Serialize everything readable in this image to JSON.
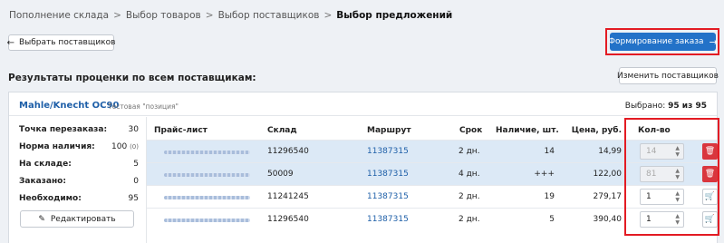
{
  "breadcrumb": {
    "items": [
      "Пополнение склада",
      "Выбор товаров",
      "Выбор поставщиков"
    ],
    "current": "Выбор предложений",
    "separator": ">"
  },
  "back_button": {
    "label": "Выбрать поставщиков",
    "icon": "arrow-left-icon"
  },
  "primary_button": {
    "label": "Формирование заказа",
    "icon": "arrow-right-icon",
    "color": "#2372c8"
  },
  "section_title": "Результаты проценки по всем поставщикам:",
  "change_button": {
    "label": "Изменить поставщиков"
  },
  "product": {
    "name": "Mahle/Knecht OC90",
    "note": "Тестовая \"позиция\"",
    "selected_label": "Выбрано:",
    "selected_count": "95 из 95"
  },
  "stats": [
    {
      "label": "Точка перезаказа:",
      "value": "30",
      "sub": ""
    },
    {
      "label": "Норма наличия:",
      "value": "100",
      "sub": "(0)"
    },
    {
      "label": "На складе:",
      "value": "5",
      "sub": ""
    },
    {
      "label": "Заказано:",
      "value": "0",
      "sub": ""
    },
    {
      "label": "Необходимо:",
      "value": "95",
      "sub": ""
    }
  ],
  "edit_button": {
    "label": "Редактировать",
    "icon": "pencil-icon"
  },
  "table": {
    "headers": {
      "pricelist": "Прайс-лист",
      "warehouse": "Склад",
      "route": "Маршрут",
      "term": "Срок",
      "stock": "Наличие, шт.",
      "price": "Цена, руб.",
      "qty": "Кол-во"
    },
    "rows": [
      {
        "warehouse": "11296540",
        "route": "11387315",
        "term": "2 дн.",
        "stock": "14",
        "price": "14,99",
        "qty": "14",
        "action": "trash-icon"
      },
      {
        "warehouse": "50009",
        "route": "11387315",
        "term": "4 дн.",
        "stock": "+++",
        "price": "122,00",
        "qty": "81",
        "action": "trash-icon"
      },
      {
        "warehouse": "11241245",
        "route": "11387315",
        "term": "2 дн.",
        "stock": "19",
        "price": "279,17",
        "qty": "1",
        "action": "cart-icon"
      },
      {
        "warehouse": "11296540",
        "route": "11387315",
        "term": "2 дн.",
        "stock": "5",
        "price": "390,40",
        "qty": "1",
        "action": "cart-icon"
      }
    ]
  },
  "colors": {
    "accent": "#2372c8",
    "highlight": "#e31b23",
    "selected_row": "#dce9f6",
    "delete": "#d9363e"
  }
}
